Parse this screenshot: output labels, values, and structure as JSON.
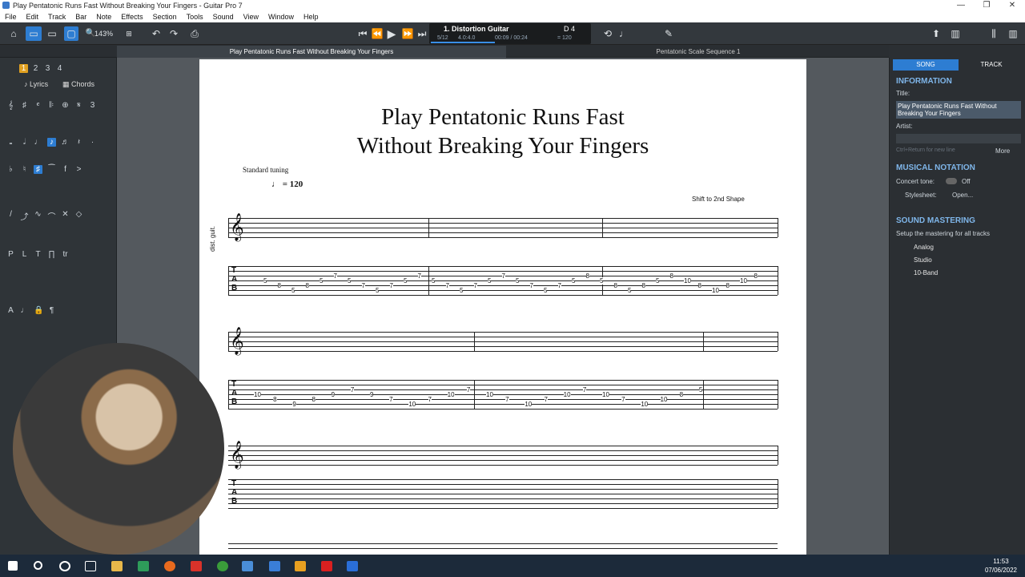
{
  "window": {
    "title": "Play Pentatonic Runs Fast Without Breaking Your Fingers - Guitar Pro 7"
  },
  "menu": [
    "File",
    "Edit",
    "Track",
    "Bar",
    "Note",
    "Effects",
    "Section",
    "Tools",
    "Sound",
    "View",
    "Window",
    "Help"
  ],
  "toolbar": {
    "zoom": "143%"
  },
  "lcd": {
    "track": "1. Distortion Guitar",
    "bar": "5/12",
    "sig": "4.0:4.0",
    "time": "00:09 / 00:24",
    "tempo": "= 120",
    "tuning": "D 4"
  },
  "tabs": [
    "Play Pentatonic Runs Fast Without Breaking Your Fingers",
    "Pentatonic Scale Sequence 1"
  ],
  "leftpanel": {
    "voices": [
      "1",
      "2",
      "3",
      "4"
    ],
    "lyrics": "Lyrics",
    "chords": "Chords"
  },
  "score": {
    "title_line1": "Play Pentatonic Runs Fast",
    "title_line2": "Without Breaking Your Fingers",
    "tuning": "Standard tuning",
    "tempo": "= 120",
    "instrument": "dist. guit.",
    "annotation": "Shift to 2nd Shape",
    "tab_row1": [
      "5",
      "8",
      "5",
      "8",
      "5",
      "7",
      "5",
      "7",
      "5",
      "7",
      "5",
      "7",
      "5",
      "7",
      "5",
      "7",
      "5",
      "7",
      "5",
      "7",
      "5",
      "7",
      "5",
      "8",
      "5",
      "8",
      "5",
      "8",
      "5",
      "8",
      "10",
      "8",
      "10",
      "8",
      "10",
      "8"
    ],
    "tab_row2": [
      "10",
      "8",
      "9",
      "8",
      "9",
      "7",
      "9",
      "7",
      "10",
      "7",
      "10",
      "7",
      "10",
      "7",
      "10",
      "7",
      "10",
      "7",
      "10",
      "7",
      "10",
      "10",
      "8",
      "5"
    ]
  },
  "rightpanel": {
    "tab_song": "SONG",
    "tab_track": "TRACK",
    "info_h": "INFORMATION",
    "title_label": "Title:",
    "title_value": "Play Pentatonic Runs Fast Without Breaking Your Fingers",
    "artist_label": "Artist:",
    "hint": "Ctrl+Return for new line",
    "more": "More",
    "notation_h": "MUSICAL NOTATION",
    "concert": "Concert tone:",
    "concert_state": "Off",
    "stylesheet": "Stylesheet:",
    "open": "Open...",
    "mastering_h": "SOUND MASTERING",
    "mastering_desc": "Setup the mastering for all tracks",
    "effects": [
      "Analog",
      "Studio",
      "10-Band"
    ]
  },
  "taskbar": {
    "time": "11:53",
    "date": "07/06/2022"
  }
}
